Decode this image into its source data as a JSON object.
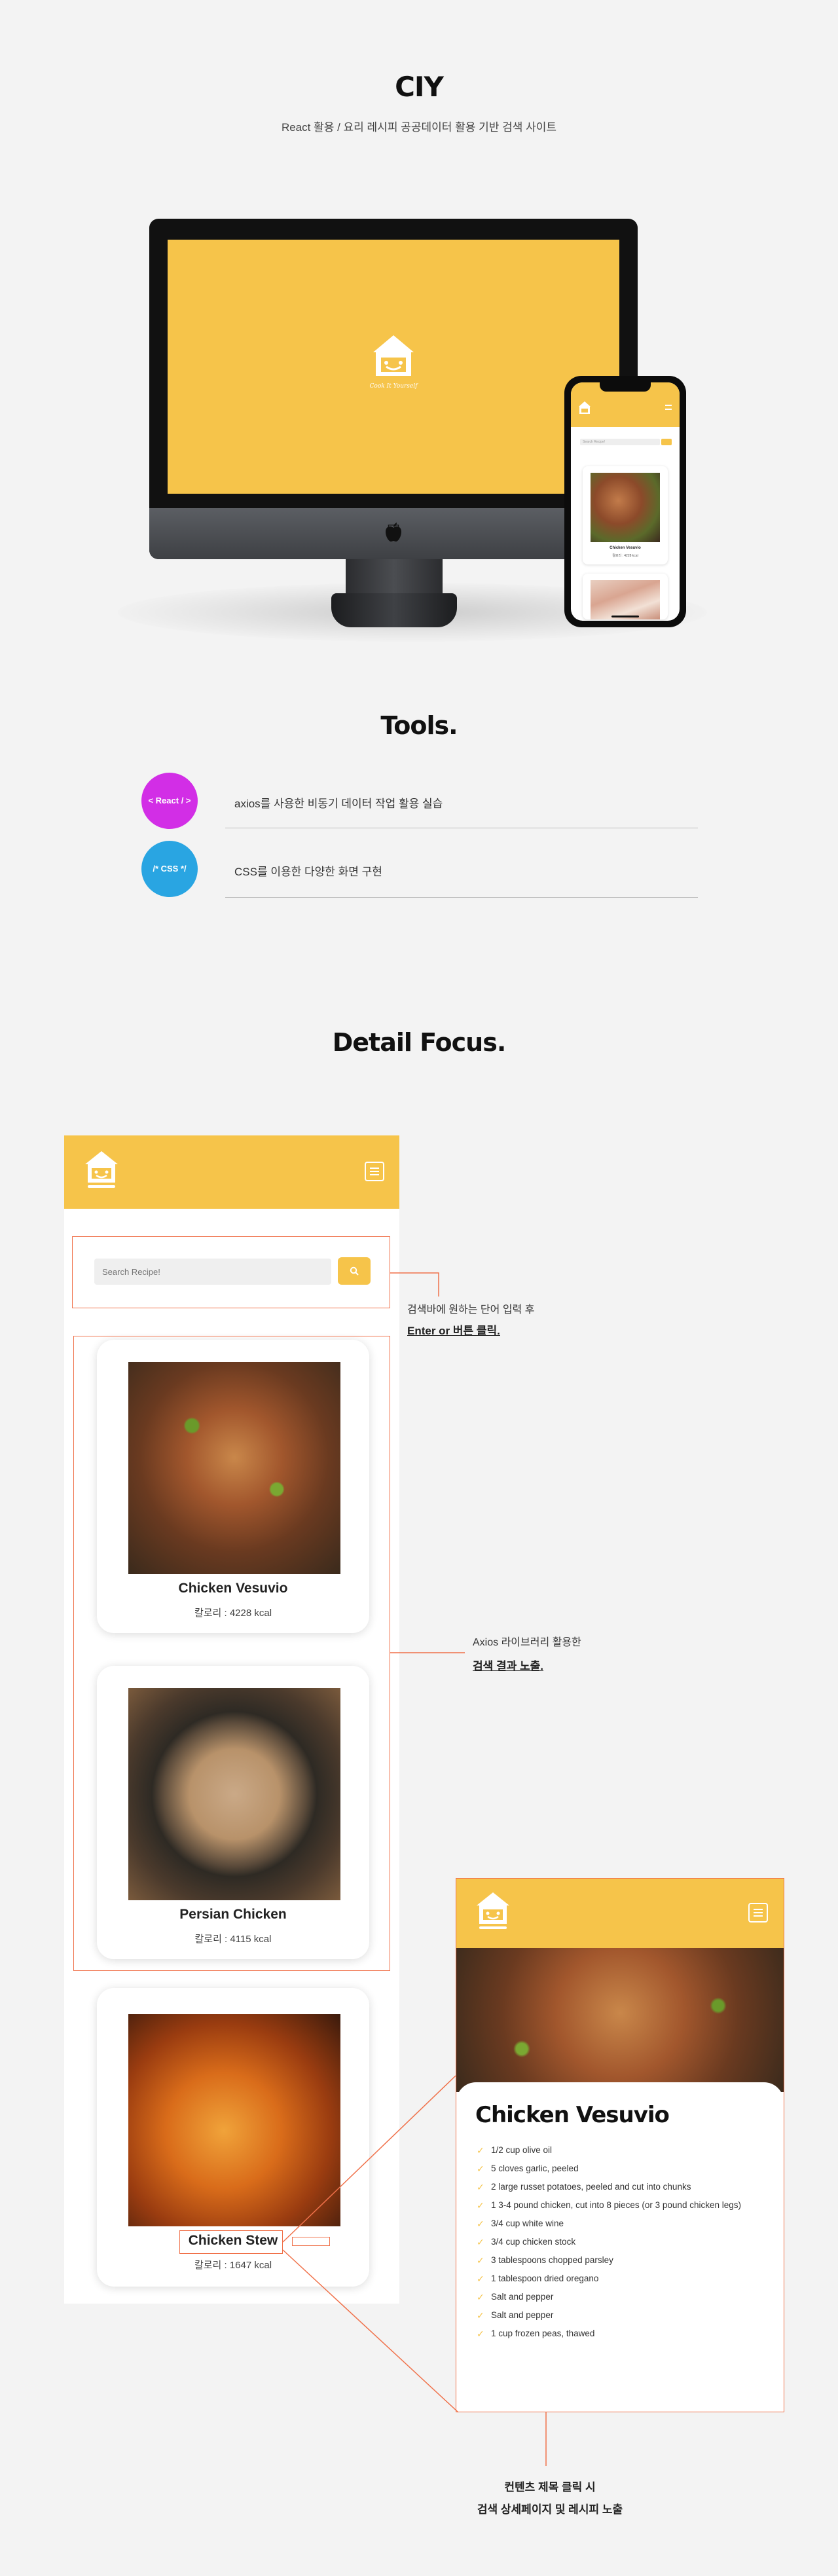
{
  "header": {
    "title": "CIY",
    "subtitle": "React 활용 / 요리 레시피 공공데이터 활용 기반 검색 사이트"
  },
  "mockup": {
    "logo_text": "Cook It Yourself",
    "phone_search_placeholder": "Search Recipe!",
    "phone_card_title": "Chicken Vesuvio",
    "phone_card_kcal": "칼로리 : 4228 kcal"
  },
  "tools": {
    "heading": "Tools.",
    "items": [
      {
        "badge": "< React / >",
        "text": "axios를 사용한 비동기 데이터 작업 활용 실습",
        "color": "#d22ee6"
      },
      {
        "badge": "/* CSS */",
        "text": "CSS를 이용한 다양한 화면 구현",
        "color": "#29a5e2"
      }
    ]
  },
  "detail_focus": {
    "heading": "Detail Focus."
  },
  "mobile": {
    "search_placeholder": "Search Recipe!",
    "search_icon": "search-icon",
    "cards": [
      {
        "title": "Chicken Vesuvio",
        "kcal": "칼로리 : 4228 kcal"
      },
      {
        "title": "Persian Chicken",
        "kcal": "칼로리 : 4115 kcal"
      },
      {
        "title": "Chicken Stew",
        "kcal": "칼로리 : 1647 kcal"
      }
    ]
  },
  "annotations": {
    "search_line1": "검색바에 원하는 단어 입력 후",
    "search_line2": "Enter or 버튼 클릭.",
    "results_line1": "Axios 라이브러리 활용한",
    "results_line2": "검색 결과 노출.",
    "detail_line1": "컨텐츠 제목 클릭 시",
    "detail_line2": "검색 상세페이지 및 레시피 노출"
  },
  "detail": {
    "title": "Chicken Vesuvio",
    "ingredients": [
      "1/2 cup olive oil",
      "5 cloves garlic, peeled",
      "2 large russet potatoes, peeled and cut into chunks",
      "1 3-4 pound chicken, cut into 8 pieces (or 3 pound chicken legs)",
      "3/4 cup white wine",
      "3/4 cup chicken stock",
      "3 tablespoons chopped parsley",
      "1 tablespoon dried oregano",
      "Salt and pepper",
      "Salt and pepper",
      "1 cup frozen peas, thawed"
    ]
  },
  "colors": {
    "brand_yellow": "#f6c44a",
    "annotation_orange": "#f0714a"
  }
}
